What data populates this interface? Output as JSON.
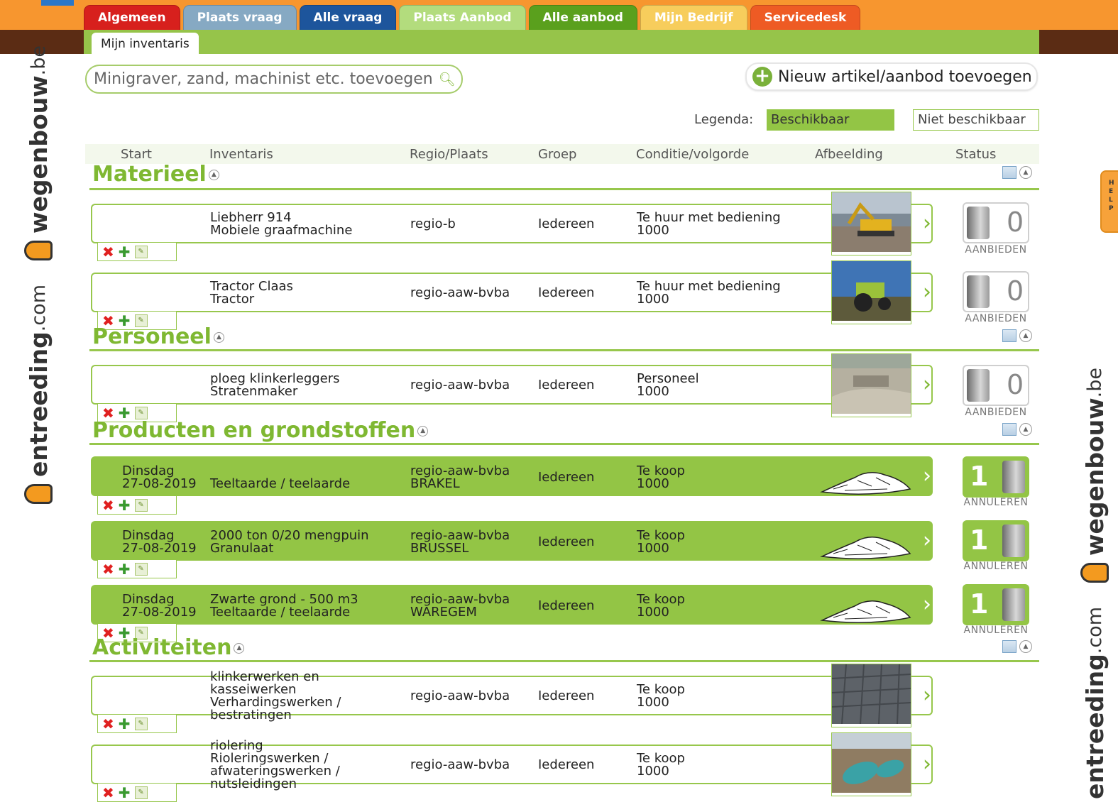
{
  "tabs": [
    {
      "label": "Algemeen",
      "color": "#d7201d"
    },
    {
      "label": "Plaats vraag",
      "color": "#86a9c3"
    },
    {
      "label": "Alle vraag",
      "color": "#1d559c"
    },
    {
      "label": "Plaats Aanbod",
      "color": "#b3dc7d"
    },
    {
      "label": "Alle aanbod",
      "color": "#5aa01d"
    },
    {
      "label": "Mijn Bedrijf",
      "color": "#f7cd5c"
    },
    {
      "label": "Servicedesk",
      "color": "#ee5b24"
    }
  ],
  "active_tab": "Plaats Aanbod",
  "subtab": {
    "label": "Mijn inventaris"
  },
  "brand": {
    "site": "wegenbouw",
    "tld": ".be",
    "site2": "entreeding",
    "tld2": ".com"
  },
  "search": {
    "placeholder": "Minigraver, zand, machinist etc. toevoegen"
  },
  "new_button": {
    "label": "Nieuw artikel/aanbod toevoegen"
  },
  "legend": {
    "label": "Legenda:",
    "available": "Beschikbaar",
    "unavailable": "Niet beschikbaar"
  },
  "columns": {
    "start": "Start",
    "inventaris": "Inventaris",
    "regio": "Regio/Plaats",
    "groep": "Groep",
    "conditie": "Conditie/volgorde",
    "afbeelding": "Afbeelding",
    "status": "Status"
  },
  "sections": {
    "materieel": "Materieel",
    "personeel": "Personeel",
    "producten": "Producten en grondstoffen",
    "activiteiten": "Activiteiten"
  },
  "rows": [
    {
      "start": "",
      "inventaris": "Liebherr 914\nMobiele graafmachine",
      "regio": "regio-b",
      "groep": "Iedereen",
      "conditie": "Te huur met bediening\n1000",
      "toggle_value": "0",
      "toggle_label": "AANBIEDEN"
    },
    {
      "start": "",
      "inventaris": "Tractor Claas\nTractor",
      "regio": "regio-aaw-bvba",
      "groep": "Iedereen",
      "conditie": "Te huur met bediening\n1000",
      "toggle_value": "0",
      "toggle_label": "AANBIEDEN"
    },
    {
      "start": "",
      "inventaris": "ploeg klinkerleggers\nStratenmaker",
      "regio": "regio-aaw-bvba",
      "groep": "Iedereen",
      "conditie": "Personeel\n1000",
      "toggle_value": "0",
      "toggle_label": "AANBIEDEN"
    },
    {
      "start": "Dinsdag\n27-08-2019",
      "inventaris": "Teeltaarde / teelaarde",
      "regio": "regio-aaw-bvba\nBRAKEL",
      "groep": "Iedereen",
      "conditie": "Te koop\n1000",
      "toggle_value": "1",
      "toggle_label": "ANNULEREN"
    },
    {
      "start": "Dinsdag\n27-08-2019",
      "inventaris": "2000 ton 0/20 mengpuin\nGranulaat",
      "regio": "regio-aaw-bvba\nBRUSSEL",
      "groep": "Iedereen",
      "conditie": "Te koop\n1000",
      "toggle_value": "1",
      "toggle_label": "ANNULEREN"
    },
    {
      "start": "Dinsdag\n27-08-2019",
      "inventaris": "Zwarte grond - 500 m3\nTeeltaarde / teelaarde",
      "regio": "regio-aaw-bvba\nWAREGEM",
      "groep": "Iedereen",
      "conditie": "Te koop\n1000",
      "toggle_value": "1",
      "toggle_label": "ANNULEREN"
    },
    {
      "start": "",
      "inventaris": "klinkerwerken en\nkasseiwerken\nVerhardingswerken /\nbestratingen",
      "regio": "regio-aaw-bvba",
      "groep": "Iedereen",
      "conditie": "Te koop\n1000",
      "toggle_value": "",
      "toggle_label": ""
    },
    {
      "start": "",
      "inventaris": "riolering\nRioleringswerken /\nafwateringswerken /\nnutsleidingen",
      "regio": "regio-aaw-bvba",
      "groep": "Iedereen",
      "conditie": "Te koop\n1000",
      "toggle_value": "",
      "toggle_label": ""
    }
  ],
  "icons": [
    "search-icon",
    "plus-circle-icon",
    "delete-icon",
    "add-icon",
    "edit-icon",
    "chevron-right-icon",
    "list-view-icon",
    "collapse-icon"
  ],
  "colors": {
    "accent_green": "#93c545",
    "header_orange": "#f7962f",
    "header_brown": "#5b2c14"
  }
}
